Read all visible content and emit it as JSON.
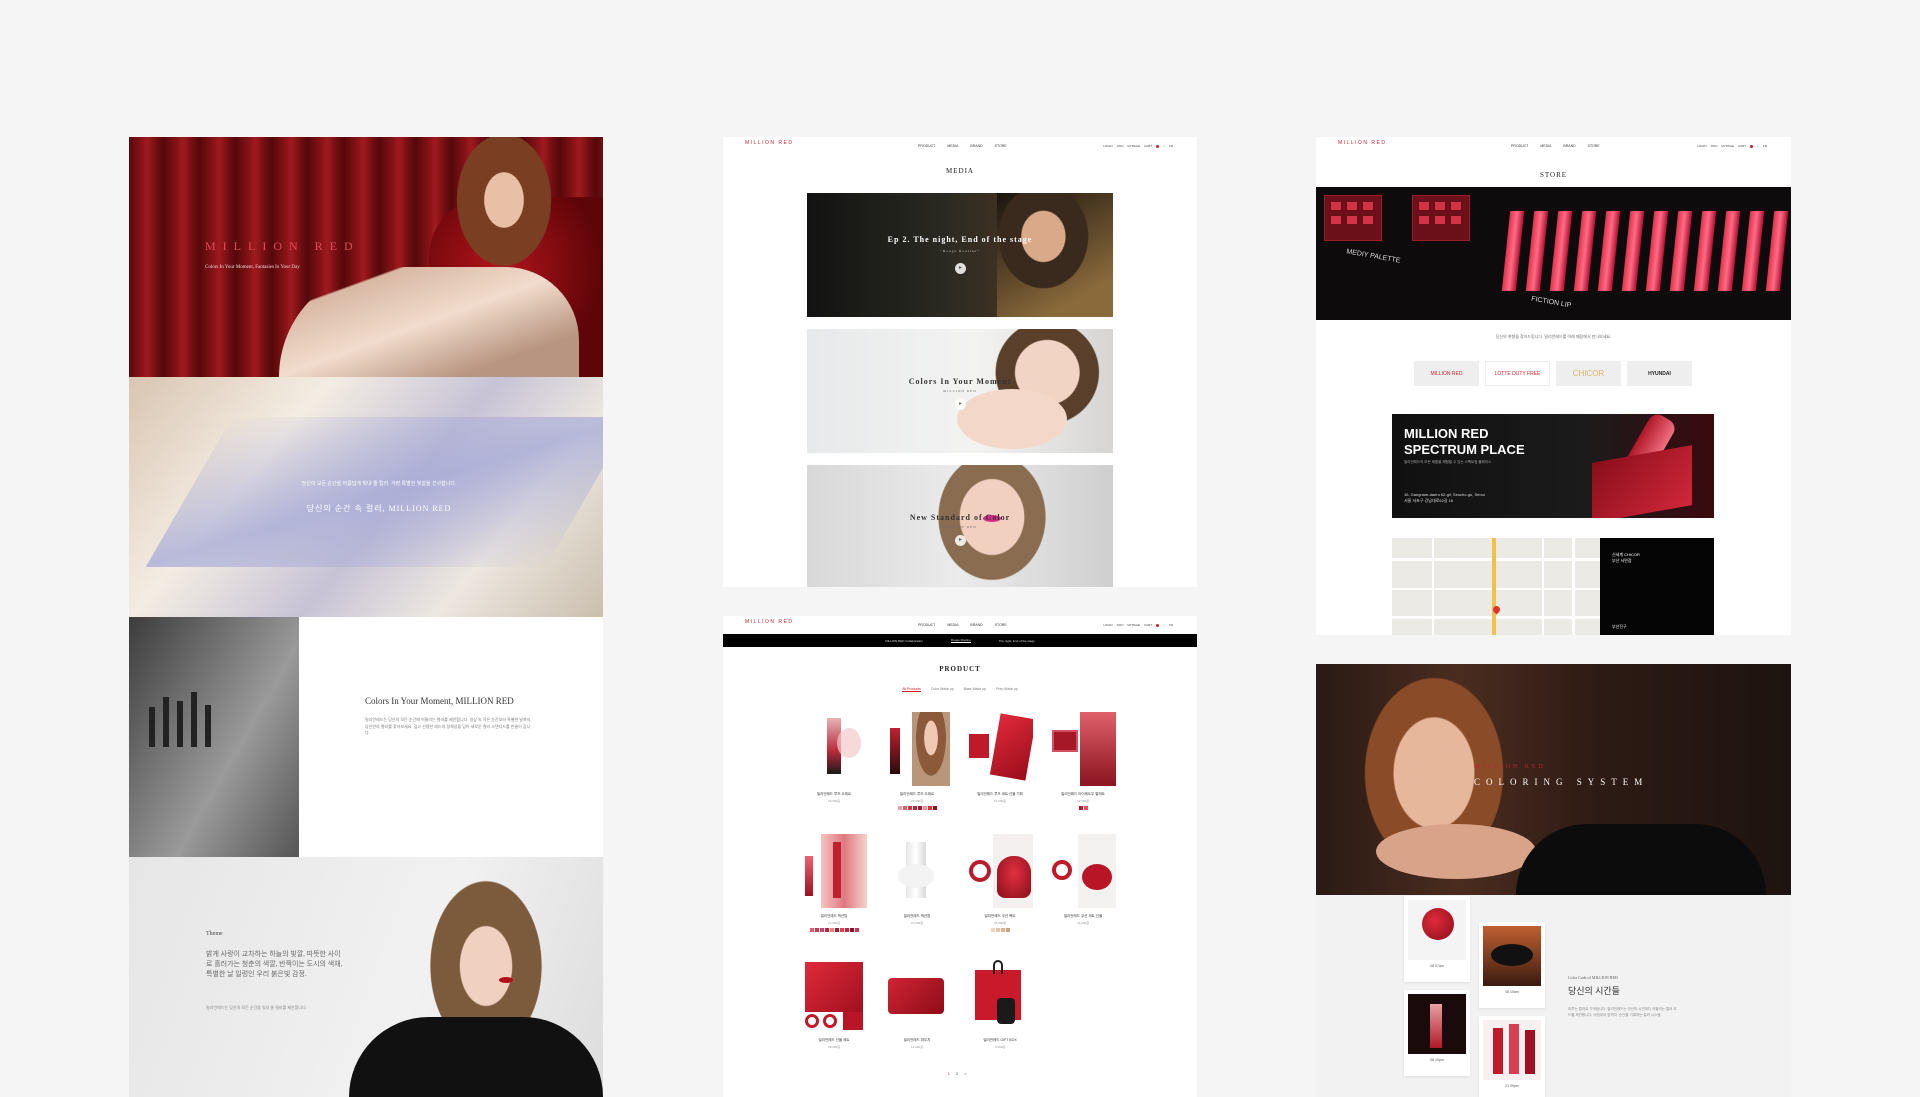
{
  "left": {
    "hero": {
      "brand": "MILLION RED",
      "tagline": "Colors In Your Moment, Fantasies In Your Day"
    },
    "glass": {
      "caption": "당신의 모든 순간을 아름답게 빛내 줄 컬러. 가장 특별한 빛깔을 선사합니다.",
      "headline": "당신의 순간 속 컬러, MILLION RED"
    },
    "about": {
      "title": "Colors In Your Moment, MILLION RED",
      "body": "밀리언레드는 당신의 모든 순간에 어울리는 컬러를 제안합니다. 일상 속 작은 순간부터 특별한 날까지, 당신만의 컬러를 찾아보세요. 깊고 선명한 레드의 정체성을 담아 새로운 컬러 스탠다드를 만들어 갑니다."
    },
    "theme": {
      "label": "Theme",
      "poem": "밝게 사랑이 교차하는 하늘의 빛깔, 따뜻한 사이로 흘러가는 청춘의 색깔, 반짝이는 도시의 색채, 특별한 날 일렁인 우리 붉은빛 감정.",
      "small": "밀리언레드는 당신의 모든 순간을 빛내 줄 컬러를 제안합니다."
    }
  },
  "nav": {
    "logo": "MILLION RED",
    "menu": [
      "PRODUCT",
      "MEDIA",
      "BRAND",
      "STORE"
    ],
    "util": [
      "LOGIN",
      "JOIN",
      "MYPAGE",
      "CART",
      "KR"
    ]
  },
  "media": {
    "title": "MEDIA",
    "videos": [
      {
        "title": "Ep 2. The night, End of the stage",
        "subtitle": "\"Rouge Rouline\""
      },
      {
        "title": "Colors In Your Moment",
        "subtitle": "MILLION RED"
      },
      {
        "title": "New Standard of Color",
        "subtitle": "MILLION RED"
      }
    ]
  },
  "store": {
    "title": "STORE",
    "shelf_labels": [
      "MEDIY PALETTE",
      "FICTION LIP"
    ],
    "intro": "당신의 취향을 찾아드립니다. 밀리언레드를 아래 매장에서 만나보세요.",
    "logos": [
      "MILLION RED",
      "LOTTE DUTY FREE",
      "CHICOR",
      "HYUNDAI"
    ],
    "spectrum": {
      "title_line1": "MILLION RED",
      "title_line2": "SPECTRUM PLACE",
      "desc": "밀리언레드의 모든 제품을 체험할 수 있는 스펙트럼 플레이스",
      "address_en": "16, Gangnam-daero 62-gil, Seocho-gu, Seoul",
      "address_ko": "서울 서초구 강남대로62길 16"
    },
    "map_side": {
      "line1": "신세계 CHICOR",
      "line2": "부산 서면점",
      "line3": "부산진구"
    }
  },
  "product": {
    "subnav": [
      "MILLION RED Collaboration",
      "Rouge Rouline",
      "The night, End of the stage"
    ],
    "title": "PRODUCT",
    "tabs": [
      "All Products",
      "Color Make up",
      "Base Make up",
      "Prep Make up"
    ],
    "items": [
      {
        "name": "밀리언레드 루즈 오래르",
        "price": "26,000원"
      },
      {
        "name": "밀리언레드 루즈 오래르",
        "price": "26,000원"
      },
      {
        "name": "밀리언레드 루즈 세트 선물 기획",
        "price": "52,000원"
      },
      {
        "name": "밀리언레드 아이쉐도우 팔레트",
        "price": "32,000원"
      },
      {
        "name": "밀리언레드 픽션립",
        "price": "22,000원"
      },
      {
        "name": "밀리언레드 픽션립",
        "price": "22,000원"
      },
      {
        "name": "밀리언레드 쿠션 팩트",
        "price": "38,000원"
      },
      {
        "name": "밀리언레드 쿠션 세트 선물",
        "price": "46,000원"
      },
      {
        "name": "밀리언레드 선물 세트",
        "price": "58,000원"
      },
      {
        "name": "밀리언레드 파우치",
        "price": "12,000원"
      },
      {
        "name": "밀리언레드 GIFT BOX",
        "price": "5,000원"
      }
    ],
    "pager": [
      "1",
      "2",
      ">"
    ]
  },
  "coloring": {
    "kicker": "MILLION RED",
    "title": "COLORING SYSTEM",
    "cards": [
      "08 07am",
      "08 10am",
      "08 10pm",
      "21 09pm"
    ],
    "info_kicker": "Color Code of MILLION RED",
    "info_title": "당신의 시간들",
    "info_body": "하루는 컬러로 기억됩니다. 밀리언레드는 당신의 시간마다 어울리는 컬러 코드를 제안합니다. 아침부터 밤까지, 순간을 기록하는 컬러 시스템."
  },
  "colors": {
    "accent": "#c4232f",
    "background": "#f5f5f5"
  }
}
